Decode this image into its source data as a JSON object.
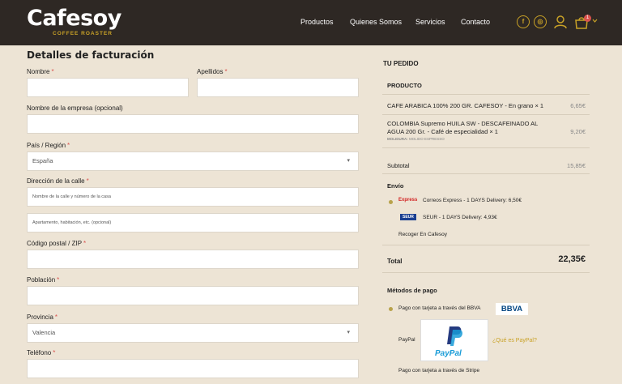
{
  "header": {
    "logo_main": "Cafesoy",
    "logo_sub": "COFFEE ROASTER",
    "nav": [
      "Productos",
      "Quienes Somos",
      "Servicios",
      "Contacto"
    ],
    "cart_count": "1",
    "icons": {
      "facebook": "f",
      "instagram": "◎"
    }
  },
  "form": {
    "title": "Detalles de facturación",
    "required_mark": "*",
    "nombre_label": "Nombre",
    "apellidos_label": "Apellidos",
    "empresa_label": "Nombre de la empresa (opcional)",
    "pais_label": "País / Región",
    "pais_value": "España",
    "direccion_label": "Dirección de la calle",
    "direccion_placeholder": "Nombre de la calle y número de la casa",
    "apartamento_placeholder": "Apartamento, habitación, etc. (opcional)",
    "cp_label": "Código postal / ZIP",
    "poblacion_label": "Población",
    "provincia_label": "Provincia",
    "provincia_value": "Valencia",
    "telefono_label": "Teléfono"
  },
  "order": {
    "title": "TU PEDIDO",
    "product_header": "PRODUCTO",
    "items": [
      {
        "name": "CAFE ARABICA 100% 200 GR. CAFESOY - En grano",
        "qty": "× 1",
        "price": "6,65€"
      },
      {
        "name_line1": "COLOMBIA Supremo HUILA SW - DESCAFEINADO AL",
        "name_line2": "AGUA 200 Gr. - Café de especialidad",
        "qty": "× 1",
        "price": "9,20€",
        "meta_key": "MOLIDURA:",
        "meta_value": "MOLIDO ESPRESSO"
      }
    ],
    "subtotal_label": "Subtotal",
    "subtotal_value": "15,85€",
    "shipping_label": "Envío",
    "shipping_options": [
      {
        "logo": "Express",
        "label": "Correos Express - 1 DAYS Delivery: 6,50€",
        "selected": true
      },
      {
        "logo": "SEUR",
        "label": "SEUR - 1 DAYS Delivery: 4,93€",
        "selected": false
      },
      {
        "label": "Recoger En Cafesoy",
        "selected": false
      }
    ],
    "total_label": "Total",
    "total_value": "22,35€",
    "payment_title": "Métodos de pago",
    "payment_bbva_label": "Pago con tarjeta a través del BBVA",
    "bbva_logo": "BBVA",
    "paypal_label": "PayPal",
    "paypal_logo": "PayPal",
    "paypal_link": "¿Qué es PayPal?",
    "stripe_label": "Pago con tarjeta a través de Stripe"
  },
  "colors": {
    "header_bg": "#2e2824",
    "page_bg": "#ede4d5",
    "accent_gold": "#c9a227",
    "required_red": "#d9534f"
  }
}
